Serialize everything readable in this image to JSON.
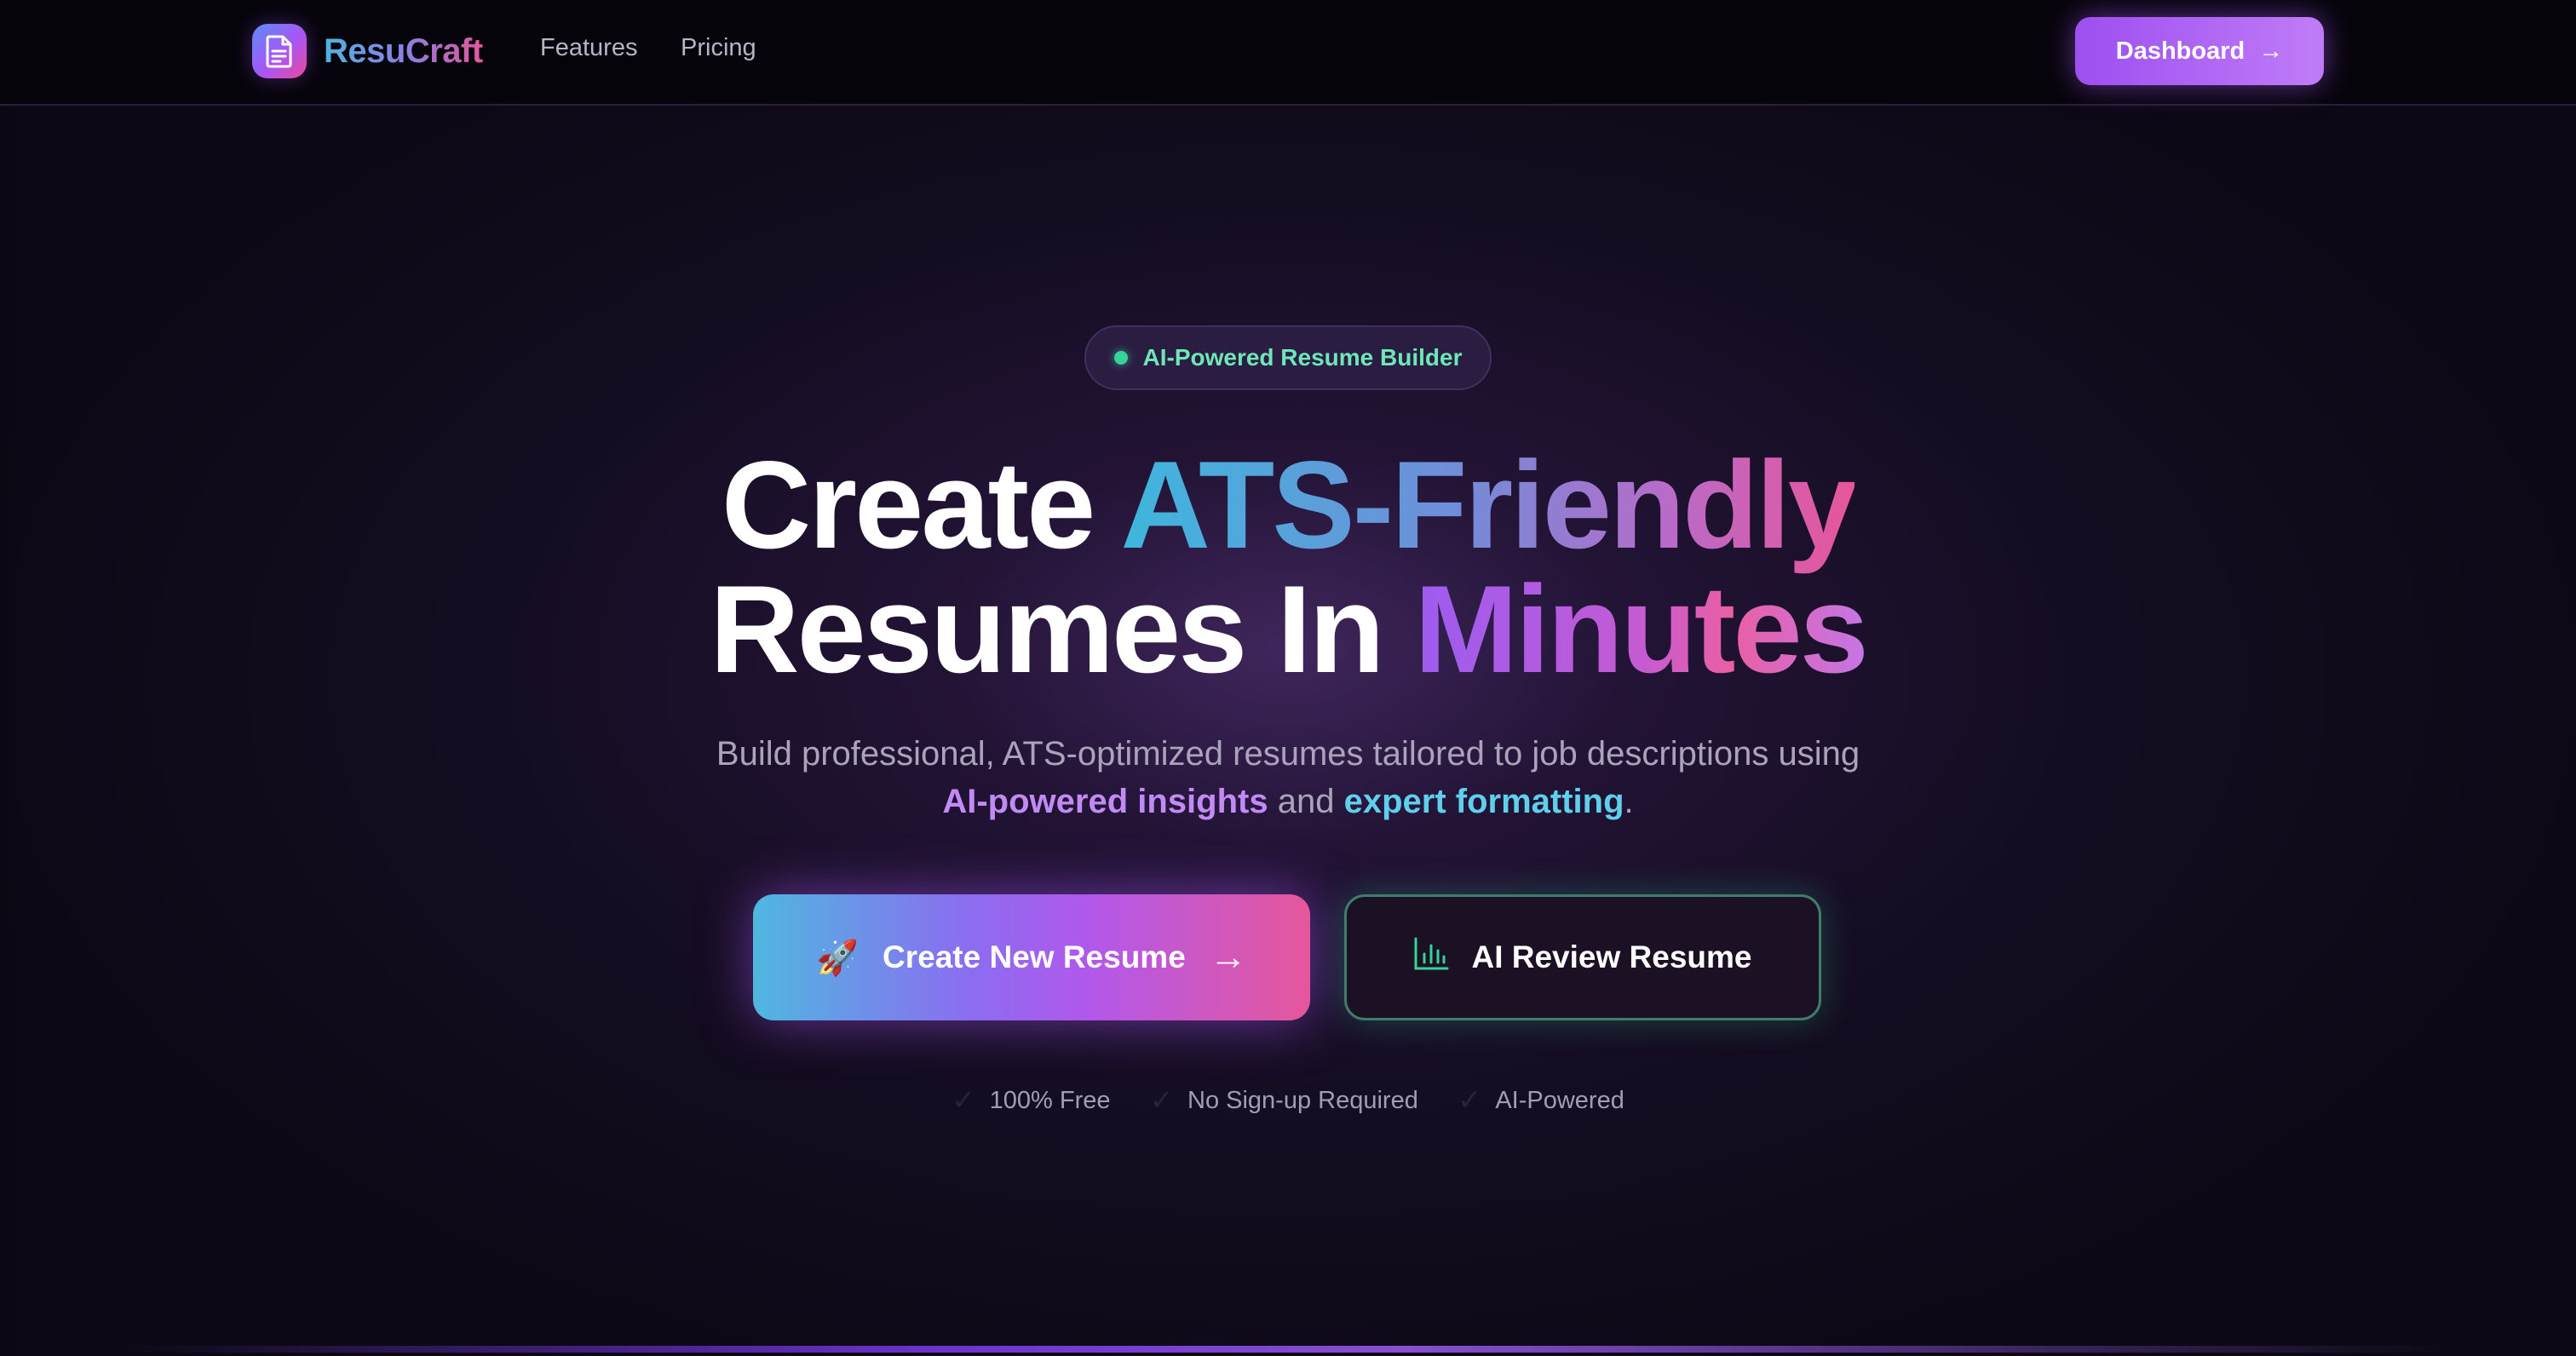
{
  "nav": {
    "brand": "ResuCraft",
    "links": [
      "Features",
      "Pricing"
    ],
    "cta_label": "Dashboard",
    "cta_arrow": "→"
  },
  "hero": {
    "badge": "AI-Powered Resume Builder",
    "headline": {
      "line1_prefix": "Create ",
      "line1_highlight": "ATS-Friendly",
      "line2_prefix": "Resumes In ",
      "line2_highlight": "Minutes"
    },
    "subtext": {
      "part1": "Build professional, ATS-optimized resumes tailored to job descriptions using",
      "highlight1": "AI-powered insights",
      "part2": " and ",
      "highlight2": "expert formatting",
      "part3": "."
    },
    "primary_button": {
      "icon": "🚀",
      "label": "Create New Resume",
      "arrow": "→"
    },
    "secondary_button": {
      "icon": "bar-chart-icon",
      "label": "AI Review Resume"
    },
    "features": [
      "100% Free",
      "No Sign-up Required",
      "AI-Powered"
    ]
  },
  "colors": {
    "background": "#150d22",
    "accent_purple": "#a855f7",
    "accent_pink": "#ec4899",
    "accent_cyan": "#4fb7e0",
    "accent_green": "#34d399"
  }
}
